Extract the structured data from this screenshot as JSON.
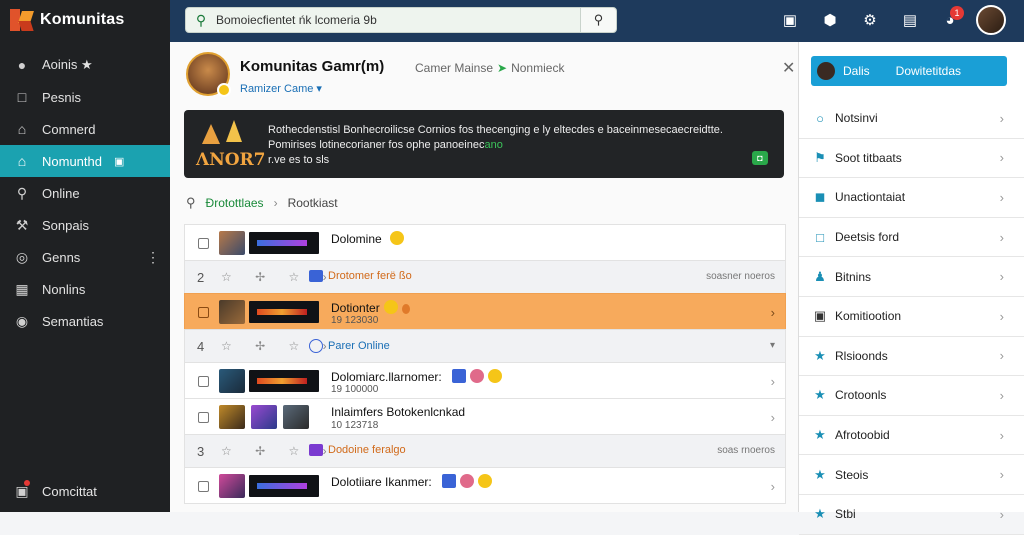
{
  "app": {
    "name": "Komunitas"
  },
  "sidebar": {
    "items": [
      {
        "label": "Aoinis ★",
        "icon": "person-icon"
      },
      {
        "label": "Pesnis",
        "icon": "document-icon"
      },
      {
        "label": "Comnerd",
        "icon": "home-icon"
      },
      {
        "label": "Nomunthd",
        "icon": "community-icon"
      },
      {
        "label": "Online",
        "icon": "search-icon"
      },
      {
        "label": "Sonpais",
        "icon": "wrench-icon"
      },
      {
        "label": "Genns",
        "icon": "target-icon"
      },
      {
        "label": "Nonlins",
        "icon": "grid-icon"
      },
      {
        "label": "Semantias",
        "icon": "globe-icon"
      }
    ],
    "bottom_label": "Comcittat"
  },
  "search": {
    "value": "Bomoiecfientet ńk lcomeria 9b"
  },
  "topbar": {
    "notification_count": "1"
  },
  "group": {
    "name": "Komunitas Gamr(m)",
    "meta_1": "Camer Mainse",
    "meta_2": "Nonmieck",
    "type": "Ramizer Came ▾"
  },
  "banner": {
    "art_text": "ΛNOR7",
    "line1": "Rothecdenstisl Bonhecroilicse Cornios fos thecenging e ly eltecdes e baceinmesecaecreidtte.",
    "line2": "Pomirises lotinecorianer fos ophe panoeinec",
    "line2_highlight": "ano",
    "line3": "r.ve es to sls",
    "badge": "◘"
  },
  "breadcrumb": {
    "part1": "Ɖrotottlaes",
    "part2": "Rootkiast"
  },
  "list": [
    {
      "kind": "item",
      "title": "Dolomine",
      "sub": "",
      "emoji": "yellow"
    },
    {
      "kind": "group",
      "num": "2",
      "tag": "Drotomer ferë ßo",
      "tag_icon": "square",
      "right": "soasner noeros"
    },
    {
      "kind": "item",
      "title": "Dotionter",
      "sub": "19 123030",
      "emoji": "yellow-orange",
      "highlighted": true
    },
    {
      "kind": "group",
      "num": "4",
      "tag": "Parer Online",
      "tag_icon": "circle",
      "right": "▾"
    },
    {
      "kind": "item",
      "title": "Dolomiarc.llarnomer:",
      "sub": "19 100000",
      "emoji": "blue-yellow"
    },
    {
      "kind": "item",
      "title": "Inlaimfers Botokenlcnkad",
      "sub": "10 123718",
      "emoji": ""
    },
    {
      "kind": "group",
      "num": "3",
      "tag": "Dodoine feralgo",
      "tag_icon": "square-purple",
      "right": "soas rnoeros"
    },
    {
      "kind": "item",
      "title": "Dolotiiare Ikanmer:",
      "sub": "",
      "emoji": "blue-pink-yellow"
    }
  ],
  "right_panel": {
    "top_a": "Dalis",
    "top_b": "Dowitetitdas",
    "items": [
      {
        "label": "Notsinvi",
        "icon": "circle-icon"
      },
      {
        "label": "Soot titbaats",
        "icon": "filter-icon"
      },
      {
        "label": "Unactiontaiat",
        "icon": "frame-icon"
      },
      {
        "label": "Deetsis ford",
        "icon": "doc-icon"
      },
      {
        "label": "Bitnins",
        "icon": "people-icon"
      },
      {
        "label": "Komitiootion",
        "icon": "box-icon"
      },
      {
        "label": "Rlsioonds",
        "icon": "star-icon"
      },
      {
        "label": "Crotoonls",
        "icon": "star-icon"
      },
      {
        "label": "Afrotoobid",
        "icon": "star-icon"
      },
      {
        "label": "Steois",
        "icon": "star-icon"
      },
      {
        "label": "Stbi",
        "icon": "star-icon"
      }
    ]
  },
  "colors": {
    "accent": "#1ba2b0",
    "topbar": "#1e3a5c",
    "highlight_row": "#f7aa5c",
    "right_button": "#1a9fd6"
  }
}
